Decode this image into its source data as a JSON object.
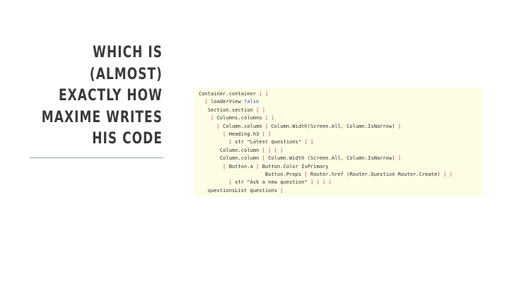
{
  "slide": {
    "title_lines": [
      "WHICH IS",
      "(ALMOST)",
      "EXACTLY HOW",
      "MAXIME WRITES",
      "HIS CODE"
    ],
    "colors": {
      "title": "#3b3b3b",
      "divider": "#8aa6b3",
      "code_background": "#fdfde6",
      "code_bracket": "#d0454a",
      "code_keyword": "#3a56c8",
      "code_text": "#2e2e2e"
    }
  },
  "code": {
    "lines": [
      {
        "indent": 0,
        "tokens": [
          {
            "t": "tx",
            "v": "Container.container "
          },
          {
            "t": "br",
            "v": "[ ]"
          }
        ]
      },
      {
        "indent": 2,
        "tokens": [
          {
            "t": "br",
            "v": "[ "
          },
          {
            "t": "tx",
            "v": "loaderView "
          },
          {
            "t": "kw",
            "v": "false"
          }
        ]
      },
      {
        "indent": 3,
        "tokens": [
          {
            "t": "tx",
            "v": "Section.section "
          },
          {
            "t": "br",
            "v": "[ ]"
          }
        ]
      },
      {
        "indent": 4,
        "tokens": [
          {
            "t": "br",
            "v": "[ "
          },
          {
            "t": "tx",
            "v": "Columns.columns "
          },
          {
            "t": "br",
            "v": "[ ]"
          }
        ]
      },
      {
        "indent": 6,
        "tokens": [
          {
            "t": "br",
            "v": "[ "
          },
          {
            "t": "tx",
            "v": "Column.column "
          },
          {
            "t": "br",
            "v": "[ "
          },
          {
            "t": "tx",
            "v": "Column.Width(Screen.All, Column.IsNarrow) "
          },
          {
            "t": "br",
            "v": "]"
          }
        ]
      },
      {
        "indent": 8,
        "tokens": [
          {
            "t": "br",
            "v": "[ "
          },
          {
            "t": "tx",
            "v": "Heading.h3 "
          },
          {
            "t": "br",
            "v": "[ ]"
          }
        ]
      },
      {
        "indent": 10,
        "tokens": [
          {
            "t": "br",
            "v": "[ "
          },
          {
            "t": "tx",
            "v": "str \"Latest questions\" "
          },
          {
            "t": "br",
            "v": "] ]"
          }
        ]
      },
      {
        "indent": 7,
        "tokens": [
          {
            "t": "tx",
            "v": "Column.column "
          },
          {
            "t": "br",
            "v": "[ ] [ ]"
          }
        ]
      },
      {
        "indent": 7,
        "tokens": [
          {
            "t": "tx",
            "v": "Column.column "
          },
          {
            "t": "br",
            "v": "[ "
          },
          {
            "t": "tx",
            "v": "Column.Width (Screen.All, Column.IsNarrow) "
          },
          {
            "t": "br",
            "v": "]"
          }
        ]
      },
      {
        "indent": 8,
        "tokens": [
          {
            "t": "br",
            "v": "[ "
          },
          {
            "t": "tx",
            "v": "Button.a "
          },
          {
            "t": "br",
            "v": "[ "
          },
          {
            "t": "tx",
            "v": "Button.Color IsPrimary"
          }
        ]
      },
      {
        "indent": 22,
        "tokens": [
          {
            "t": "tx",
            "v": "Button.Props "
          },
          {
            "t": "br",
            "v": "[ "
          },
          {
            "t": "tx",
            "v": "Router.href (Router.Question Router.Create) "
          },
          {
            "t": "br",
            "v": "] ]"
          }
        ]
      },
      {
        "indent": 10,
        "tokens": [
          {
            "t": "br",
            "v": "[ "
          },
          {
            "t": "tx",
            "v": "str \"Ask a new question\" "
          },
          {
            "t": "br",
            "v": "] ] ] ]"
          }
        ]
      },
      {
        "indent": 3,
        "tokens": [
          {
            "t": "tx",
            "v": "questionsList questions "
          },
          {
            "t": "br",
            "v": "]"
          }
        ]
      }
    ]
  }
}
